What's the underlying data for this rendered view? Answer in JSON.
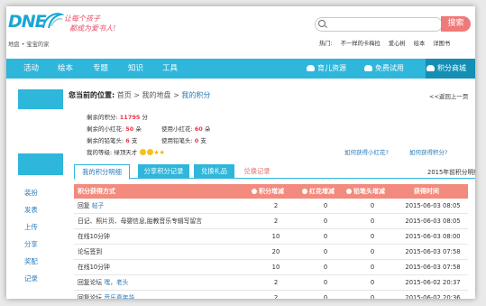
{
  "header": {
    "logo_text": "DNE",
    "slogan_line1": "让每个孩子",
    "slogan_line2": "都成为爱书人!",
    "subtitle": "地盘 • 宝宝的家",
    "search_button": "搜索",
    "hot_label": "热门:",
    "hot_links": [
      "不一样的卡梅拉",
      "爱心树",
      "绘本",
      "详图书"
    ]
  },
  "nav": {
    "items": [
      "活动",
      "绘本",
      "专题",
      "知识",
      "工具"
    ],
    "right_items": [
      "育儿资源",
      "免费试用",
      "积分商城"
    ]
  },
  "sidebar": {
    "links": [
      "装扮",
      "发表",
      "上传",
      "分享",
      "奖配",
      "记录"
    ]
  },
  "location": {
    "label": "您当前的位置:",
    "crumbs": [
      "首页",
      ">",
      "我的地盘",
      ">"
    ],
    "current": "我的积分",
    "back": "<<返回上一页"
  },
  "stats": {
    "points_label": "剩余的积分:",
    "points_value": "11795",
    "points_unit": "分",
    "flower_label": "剩余的小红花:",
    "flower_value": "50",
    "flower_unit": "朵",
    "used_flower_label": "使用小红花:",
    "used_flower_value": "60",
    "used_flower_unit": "朵",
    "pencil_label": "剩余的铅笔头:",
    "pencil_value": "6",
    "pencil_unit": "支",
    "used_pencil_label": "使用铅笔头:",
    "used_pencil_value": "0",
    "used_pencil_unit": "支",
    "level_label": "我的等级:",
    "level_value": "绿顶天才",
    "how_flower": "如何获得小红花?",
    "how_points": "如何获得积分?"
  },
  "tabs": [
    "我的积分明细",
    "分享积分记录",
    "兑换礼品",
    "兑换记录"
  ],
  "year_label": "2015年前积分明细",
  "table": {
    "headers": [
      "积分获得方式",
      "积分增减",
      "红花增减",
      "铅笔头增减",
      "获得时间"
    ],
    "rows": [
      {
        "method": "回复",
        "link": "帖子",
        "points": "2",
        "flower": "0",
        "pencil": "0",
        "time": "2015-06-03 08:05"
      },
      {
        "method": "日记、照片页、母婴信息,胎教音乐专辑写留言",
        "link": "",
        "points": "2",
        "flower": "0",
        "pencil": "0",
        "time": "2015-06-03 08:05"
      },
      {
        "method": "在线10分钟",
        "link": "",
        "points": "10",
        "flower": "0",
        "pencil": "0",
        "time": "2015-06-03 08:00"
      },
      {
        "method": "论坛签到",
        "link": "",
        "points": "20",
        "flower": "0",
        "pencil": "0",
        "time": "2015-06-03 07:58"
      },
      {
        "method": "在线10分钟",
        "link": "",
        "points": "10",
        "flower": "0",
        "pencil": "0",
        "time": "2015-06-03 07:58"
      },
      {
        "method": "回复论坛",
        "link": "嘿，老头",
        "points": "2",
        "flower": "0",
        "pencil": "0",
        "time": "2015-06-02 20:37"
      },
      {
        "method": "回复论坛",
        "link": "音乐嘉年华",
        "points": "2",
        "flower": "0",
        "pencil": "0",
        "time": "2015-06-02 20:36"
      }
    ]
  },
  "colors": {
    "accent": "#2fb6db",
    "table_header": "#f28b7d",
    "highlight_red": "#e8374a",
    "search_button": "#f07a7a"
  }
}
